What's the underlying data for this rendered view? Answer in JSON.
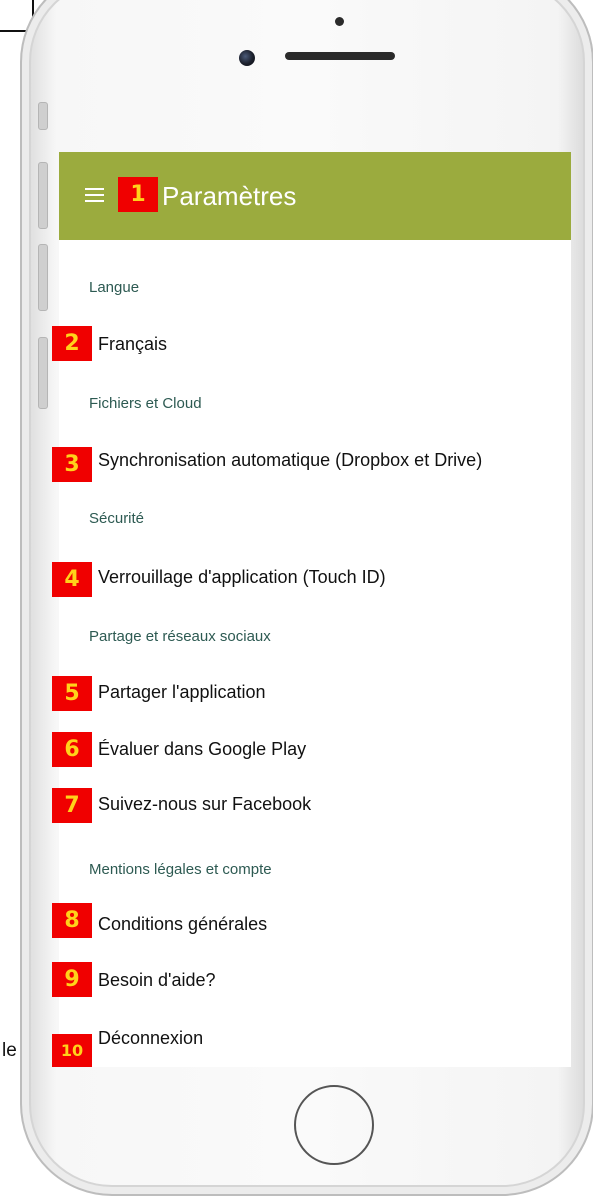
{
  "doc_fragment": {
    "trailing_text": "le"
  },
  "header": {
    "title": "Paramètres"
  },
  "sections": [
    {
      "label": "Langue",
      "items": [
        {
          "label": "Français"
        }
      ]
    },
    {
      "label": "Fichiers et Cloud",
      "items": [
        {
          "label": "Synchronisation automatique (Dropbox et Drive)"
        }
      ]
    },
    {
      "label": "Sécurité",
      "items": [
        {
          "label": "Verrouillage d'application (Touch ID)"
        }
      ]
    },
    {
      "label": "Partage et réseaux sociaux",
      "items": [
        {
          "label": "Partager l'application"
        },
        {
          "label": "Évaluer dans Google Play"
        },
        {
          "label": "Suivez-nous sur Facebook"
        }
      ]
    },
    {
      "label": "Mentions légales et compte",
      "items": [
        {
          "label": "Conditions générales"
        },
        {
          "label": "Besoin d'aide?"
        },
        {
          "label": "Déconnexion"
        }
      ]
    }
  ],
  "callouts": [
    "1",
    "2",
    "3",
    "4",
    "5",
    "6",
    "7",
    "8",
    "9",
    "10"
  ],
  "colors": {
    "appbar": "#9bab3e",
    "section_text": "#2d5a52",
    "callout_bg": "#f00000",
    "callout_text": "#ffd21a"
  },
  "icons": {
    "menu": "hamburger-menu-icon"
  }
}
